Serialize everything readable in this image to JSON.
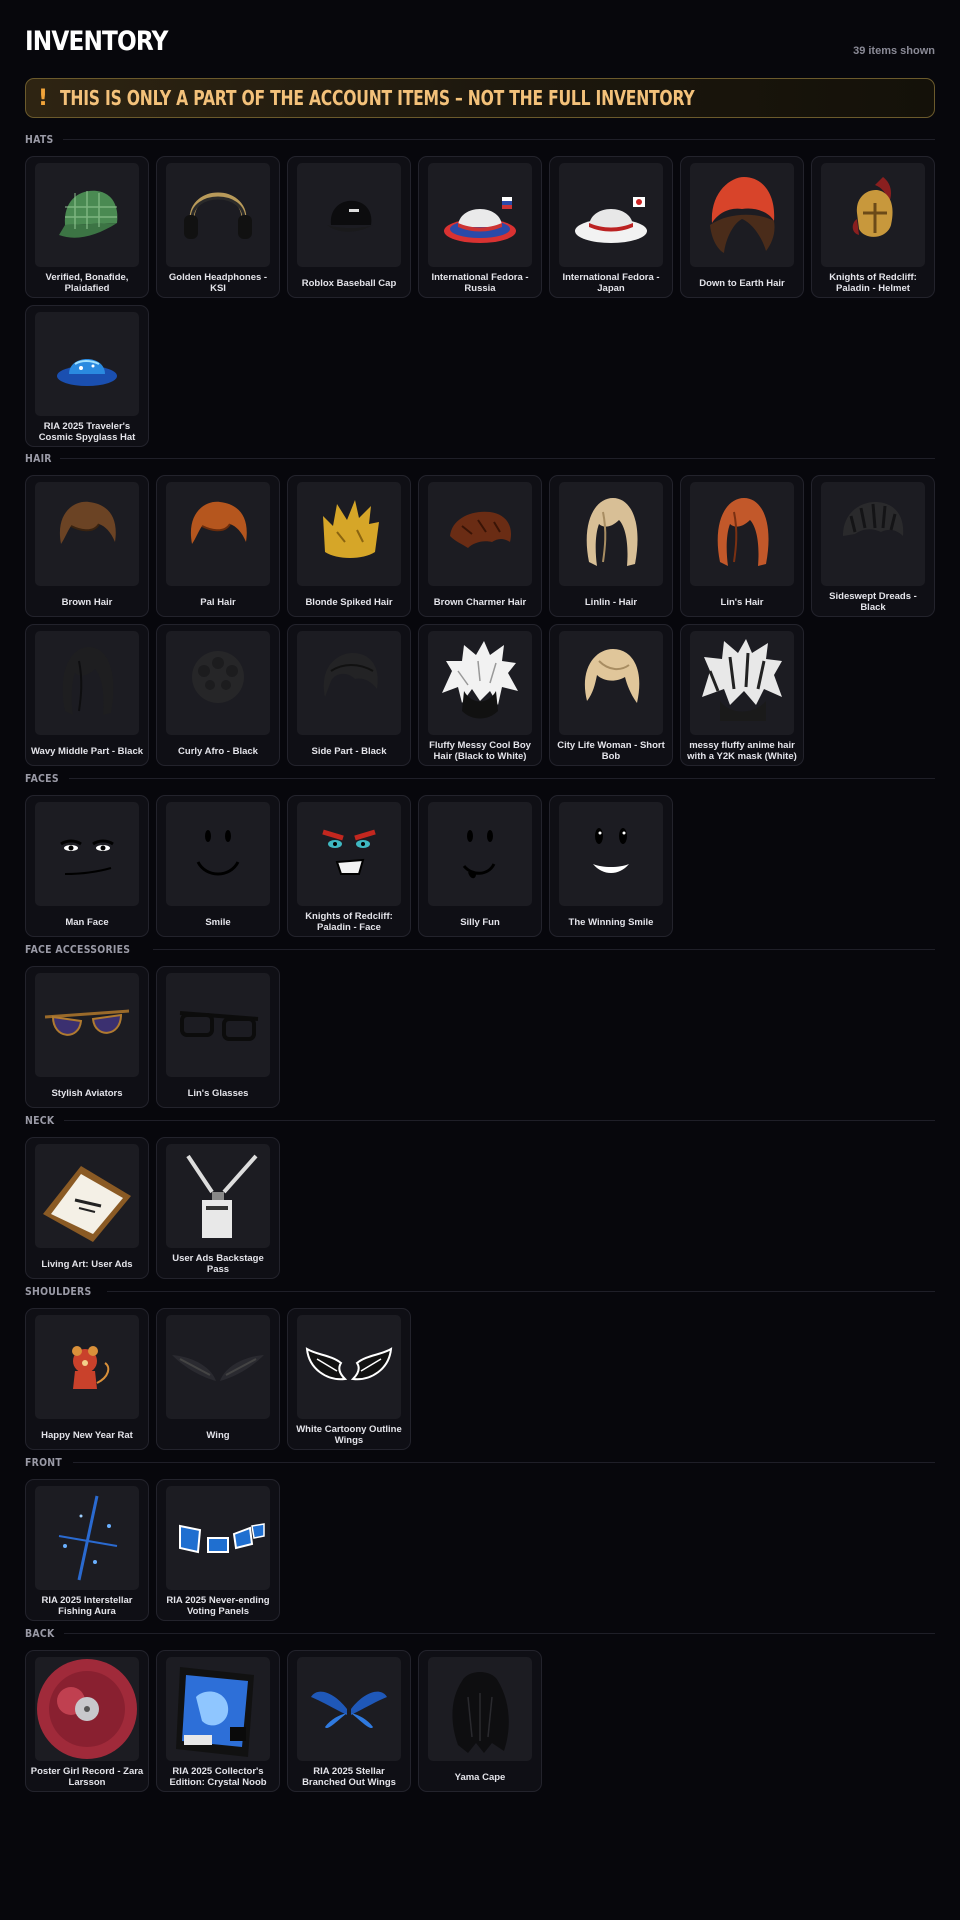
{
  "header": {
    "title": "INVENTORY",
    "count_label": "39 items shown"
  },
  "banner": {
    "icon": "!",
    "text": "THIS IS ONLY A PART OF THE ACCOUNT ITEMS – NOT THE FULL INVENTORY"
  },
  "sections": [
    {
      "title": "HATS",
      "items": [
        {
          "name": "Verified, Bonafide, Plaidafied",
          "icon": "green-plaid-cap-icon"
        },
        {
          "name": "Golden Headphones - KSI",
          "icon": "headphones-icon"
        },
        {
          "name": "Roblox Baseball Cap",
          "icon": "baseball-cap-icon"
        },
        {
          "name": "International Fedora - Russia",
          "icon": "fedora-russia-icon"
        },
        {
          "name": "International Fedora - Japan",
          "icon": "fedora-japan-icon"
        },
        {
          "name": "Down to Earth Hair",
          "icon": "red-beanie-hair-icon"
        },
        {
          "name": "Knights of Redcliff: Paladin - Helmet",
          "icon": "knight-helmet-icon"
        },
        {
          "name": "RIA 2025 Traveler's Cosmic Spyglass Hat",
          "icon": "cosmic-hat-icon"
        }
      ]
    },
    {
      "title": "HAIR",
      "items": [
        {
          "name": "Brown Hair",
          "icon": "brown-hair-icon"
        },
        {
          "name": "Pal Hair",
          "icon": "orange-hair-icon"
        },
        {
          "name": "Blonde Spiked Hair",
          "icon": "blonde-spiked-hair-icon"
        },
        {
          "name": "Brown Charmer Hair",
          "icon": "brown-charmer-hair-icon"
        },
        {
          "name": "Linlin - Hair",
          "icon": "blonde-long-hair-icon"
        },
        {
          "name": "Lin's Hair",
          "icon": "ginger-long-hair-icon"
        },
        {
          "name": "Sideswept Dreads - Black",
          "icon": "dreads-icon"
        },
        {
          "name": "Wavy Middle Part - Black",
          "icon": "black-wavy-hair-icon"
        },
        {
          "name": "Curly Afro - Black",
          "icon": "black-afro-icon"
        },
        {
          "name": "Side Part - Black",
          "icon": "black-side-part-icon"
        },
        {
          "name": "Fluffy Messy Cool Boy Hair (Black to White)",
          "icon": "fluffy-white-hair-icon"
        },
        {
          "name": "City Life Woman - Short Bob",
          "icon": "blonde-bob-icon"
        },
        {
          "name": "messy fluffy anime hair with a Y2K mask (White)",
          "icon": "anime-hair-mask-icon"
        }
      ]
    },
    {
      "title": "FACES",
      "items": [
        {
          "name": "Man Face",
          "icon": "man-face-icon"
        },
        {
          "name": "Smile",
          "icon": "smile-face-icon"
        },
        {
          "name": "Knights of Redcliff: Paladin - Face",
          "icon": "paladin-face-icon"
        },
        {
          "name": "Silly Fun",
          "icon": "silly-fun-face-icon"
        },
        {
          "name": "The Winning Smile",
          "icon": "winning-smile-face-icon"
        }
      ]
    },
    {
      "title": "FACE ACCESSORIES",
      "items": [
        {
          "name": "Stylish Aviators",
          "icon": "aviators-icon"
        },
        {
          "name": "Lin's Glasses",
          "icon": "glasses-icon"
        }
      ]
    },
    {
      "title": "NECK",
      "items": [
        {
          "name": "Living Art: User Ads",
          "icon": "framed-art-icon"
        },
        {
          "name": "User Ads Backstage Pass",
          "icon": "backstage-pass-icon"
        }
      ]
    },
    {
      "title": "SHOULDERS",
      "items": [
        {
          "name": "Happy New Year Rat",
          "icon": "rat-icon"
        },
        {
          "name": "Wing",
          "icon": "dark-wing-icon"
        },
        {
          "name": "White Cartoony Outline Wings",
          "icon": "outline-wings-icon"
        }
      ]
    },
    {
      "title": "FRONT",
      "items": [
        {
          "name": "RIA 2025 Interstellar Fishing Aura",
          "icon": "fishing-aura-icon"
        },
        {
          "name": "RIA 2025 Never-ending Voting Panels",
          "icon": "voting-panels-icon"
        }
      ]
    },
    {
      "title": "BACK",
      "items": [
        {
          "name": "Poster Girl Record - Zara Larsson",
          "icon": "vinyl-record-icon"
        },
        {
          "name": "RIA 2025 Collector's Edition: Crystal Noob",
          "icon": "collector-box-icon"
        },
        {
          "name": "RIA 2025 Stellar Branched Out Wings",
          "icon": "stellar-wings-icon"
        },
        {
          "name": "Yama Cape",
          "icon": "cape-icon"
        }
      ]
    }
  ]
}
